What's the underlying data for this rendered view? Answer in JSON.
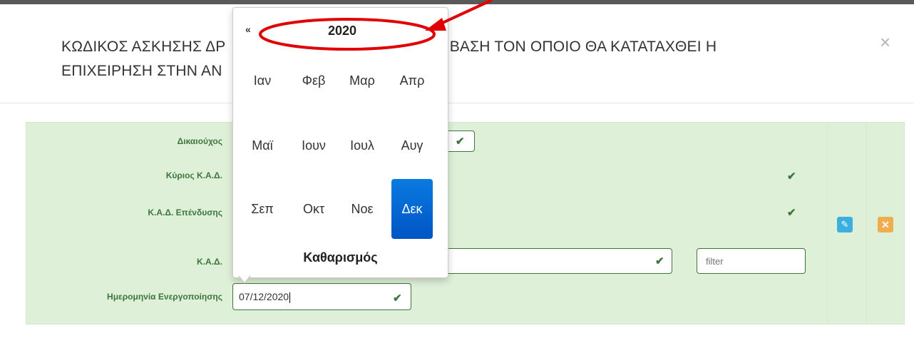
{
  "modal": {
    "title_line1_left": "ΚΩΔΙΚΟΣ ΑΣΚΗΣΗΣ ΔΡ",
    "title_line1_right": ") ΜΕ ΒΑΣΗ ΤΟΝ ΟΠΟΙΟ ΘΑ ΚΑΤΑΤΑΧΘΕΙ Η",
    "title_line2_left": "ΕΠΙΧΕΙΡΗΣΗ ΣΤΗΝ ΑΝ",
    "close_label": "×"
  },
  "form": {
    "labels": {
      "beneficiary": "Δικαιούχος",
      "main_kad": "Κύριος Κ.Α.Δ.",
      "investment_kad": "Κ.Α.Δ. Επένδυσης",
      "kad": "Κ.Α.Δ.",
      "activation_date": "Ημερομηνία Ενεργοποίησης"
    },
    "filter_placeholder": "filter",
    "activation_date_value": "07/12/2020"
  },
  "datepicker": {
    "prev_label": "«",
    "year": "2020",
    "months": [
      "Ιαν",
      "Φεβ",
      "Μαρ",
      "Απρ",
      "Μαϊ",
      "Ιουν",
      "Ιουλ",
      "Αυγ",
      "Σεπ",
      "Οκτ",
      "Νοε",
      "Δεκ"
    ],
    "selected_month": "Δεκ",
    "clear_label": "Καθαρισμός"
  },
  "actions": {
    "edit_icon": "edit-icon",
    "cancel_icon": "close-icon"
  },
  "colors": {
    "success_bg": "#dff0d8",
    "success_text": "#3c763d",
    "edit_button": "#3bb0e0",
    "cancel_button": "#f0ad4e",
    "active_month": "#0054c4",
    "annotation_red": "#e00000"
  }
}
